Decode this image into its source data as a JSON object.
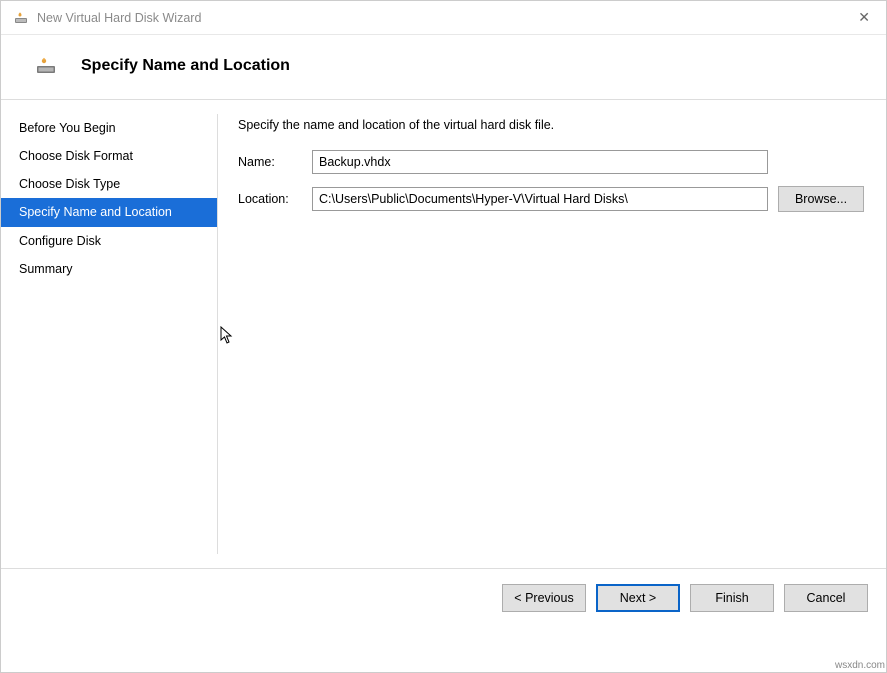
{
  "window": {
    "title": "New Virtual Hard Disk Wizard"
  },
  "header": {
    "title": "Specify Name and Location"
  },
  "sidebar": {
    "items": [
      {
        "label": "Before You Begin"
      },
      {
        "label": "Choose Disk Format"
      },
      {
        "label": "Choose Disk Type"
      },
      {
        "label": "Specify Name and Location"
      },
      {
        "label": "Configure Disk"
      },
      {
        "label": "Summary"
      }
    ]
  },
  "main": {
    "instruction": "Specify the name and location of the virtual hard disk file.",
    "name_label": "Name:",
    "name_value": "Backup.vhdx",
    "location_label": "Location:",
    "location_value": "C:\\Users\\Public\\Documents\\Hyper-V\\Virtual Hard Disks\\",
    "browse_label": "Browse..."
  },
  "footer": {
    "previous": "< Previous",
    "next": "Next >",
    "finish": "Finish",
    "cancel": "Cancel"
  },
  "watermark": "wsxdn.com"
}
